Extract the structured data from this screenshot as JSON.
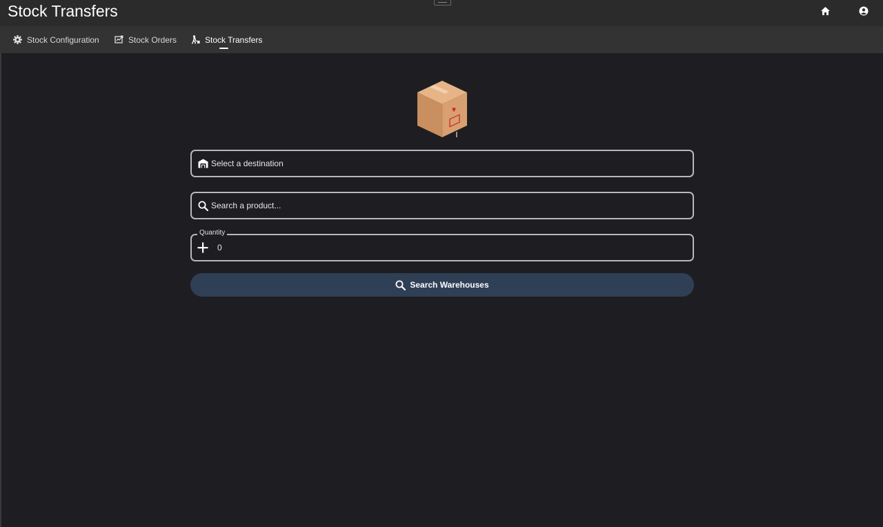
{
  "app": {
    "title": "Stock Transfers"
  },
  "header": {
    "icons": [
      "home-icon",
      "account-circle-icon"
    ]
  },
  "tabs": [
    {
      "label": "Stock Configuration",
      "icon": "gear-icon",
      "active": false
    },
    {
      "label": "Stock Orders",
      "icon": "orders-icon",
      "active": false
    },
    {
      "label": "Stock Transfers",
      "icon": "transfer-person-icon",
      "active": true
    }
  ],
  "form": {
    "destination": {
      "placeholder": "Select a destination",
      "icon": "warehouse-icon"
    },
    "product": {
      "placeholder": "Search a product...",
      "icon": "search-icon"
    },
    "quantity": {
      "label": "Quantity",
      "value": "0",
      "icon": "plus-icon"
    },
    "submit": {
      "label": "Search Warehouses",
      "icon": "search-icon"
    }
  },
  "colors": {
    "background": "#1e1e22",
    "title_bar": "#2b2b2b",
    "tab_bar": "#333333",
    "button": "#2f3f55",
    "box": "#d49a6a"
  }
}
